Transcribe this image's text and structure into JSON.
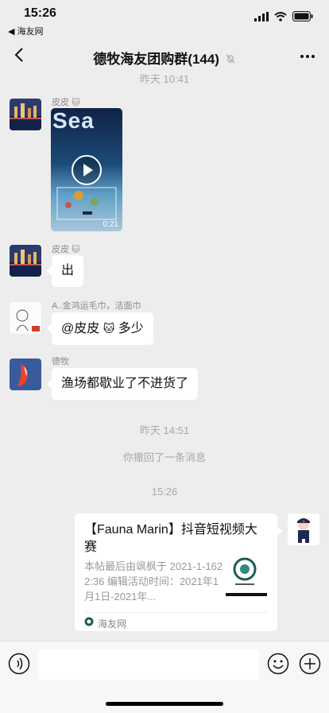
{
  "status": {
    "time": "15:26",
    "back_app": "◀ 海友网"
  },
  "header": {
    "title": "德牧海友团购群(144)"
  },
  "messages": {
    "ts1": "昨天 10:41",
    "m1_sender": "皮皮",
    "video_text": "Sea",
    "video_duration": "0:21",
    "m2_sender": "皮皮",
    "m2_text": "出",
    "m3_sender": "A..金鸿运毛巾，洁面巾",
    "m3_text_a": "@皮皮",
    "m3_text_b": "多少",
    "m4_sender": "德牧",
    "m4_text": "渔场都歇业了不进货了",
    "ts2": "昨天 14:51",
    "recall": "你撤回了一条消息",
    "ts3": "15:26"
  },
  "card": {
    "title": "【Fauna Marin】抖音短视频大赛",
    "desc": "本帖最后由飒枫于 2021-1-1622:36 编辑活动时间：2021年1月1日-2021年...",
    "source": "海友网"
  },
  "icons": [
    "back-icon",
    "mute-icon",
    "more-icon",
    "play-icon",
    "voice-icon",
    "emoji-icon",
    "plus-icon",
    "wifi-icon",
    "battery-icon",
    "signal-icon"
  ]
}
